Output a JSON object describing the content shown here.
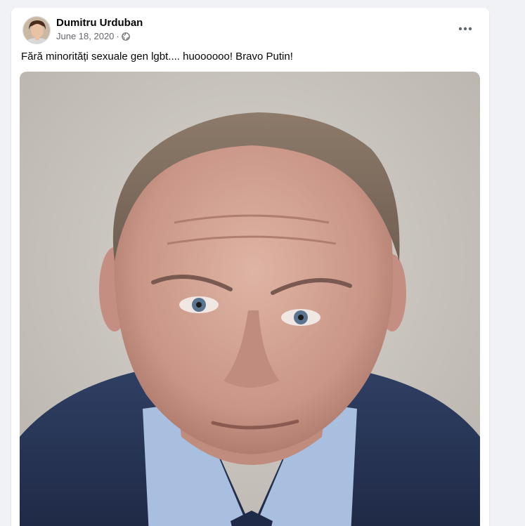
{
  "post": {
    "author": "Dumitru Urduban",
    "date": "June 18, 2020",
    "separator": "·",
    "privacy_icon": "globe-icon",
    "more_icon": "more-options-icon",
    "text": "Fără minorități sexuale gen lgbt.... huoooooo! Bravo Putin!",
    "image": "photo of a man in a dark suit and light blue shirt against a gray background"
  },
  "colors": {
    "card_background": "#ffffff",
    "page_background": "#f0f2f5",
    "secondary_text": "#65676b",
    "primary_text": "#050505"
  }
}
